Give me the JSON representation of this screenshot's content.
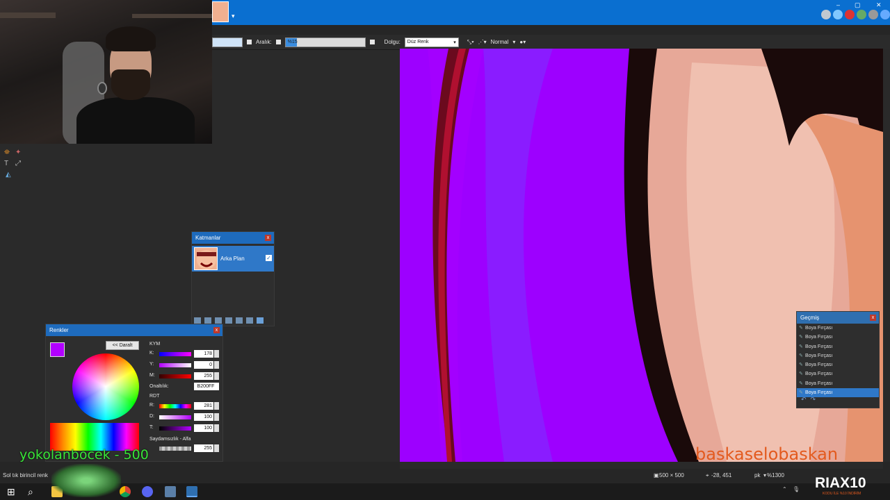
{
  "toolbar": {
    "aralik_label": "Aralık:",
    "aralik_value": "%15",
    "dolgu_label": "Dolgu:",
    "dolgu_value": "Düz Renk",
    "blend_mode": "Normal"
  },
  "layers": {
    "title": "Katmanlar",
    "close": "x",
    "items": [
      {
        "name": "Arka Plan",
        "visible": true
      }
    ]
  },
  "colors": {
    "title": "Renkler",
    "close": "x",
    "collapse_label": "<< Daralt",
    "primary": "#B200FF",
    "secondary": "#FFFFFF",
    "hsv_title": "KYM",
    "hsv": [
      {
        "label": "K:",
        "value": "178"
      },
      {
        "label": "Y:",
        "value": "0"
      },
      {
        "label": "M:",
        "value": "255"
      }
    ],
    "hex_label": "Onaltılık:",
    "hex_value": "B200FF",
    "rgb_title": "RDT",
    "rgb": [
      {
        "label": "R:",
        "value": "281"
      },
      {
        "label": "D:",
        "value": "100"
      },
      {
        "label": "T:",
        "value": "100"
      }
    ],
    "alpha_label": "Saydamsızlık - Alfa",
    "alpha_value": "255"
  },
  "history": {
    "title": "Geçmiş",
    "close": "x",
    "items": [
      "Boya Fırçası",
      "Boya Fırçası",
      "Boya Fırçası",
      "Boya Fırçası",
      "Boya Fırçası",
      "Boya Fırçası",
      "Boya Fırçası",
      "Boya Fırçası"
    ],
    "selected_index": 7
  },
  "status": {
    "hint": "Sol tık birincil renk",
    "image_size": "500 × 500",
    "cursor": "-28, 451",
    "units": "pk",
    "zoom": "%1300"
  },
  "overlays": {
    "green_text": "yokolanbocek - 500",
    "orange_text": "baskaselobaskan",
    "brand": "RIAX10",
    "brand_sub": "KODU İLE %10 İNDİRİM"
  },
  "icons": [
    "undo-icon",
    "redo-icon",
    "windows-start-icon",
    "search-icon",
    "file-explorer-icon",
    "chrome-icon",
    "discord-icon",
    "paint-net-icon"
  ]
}
